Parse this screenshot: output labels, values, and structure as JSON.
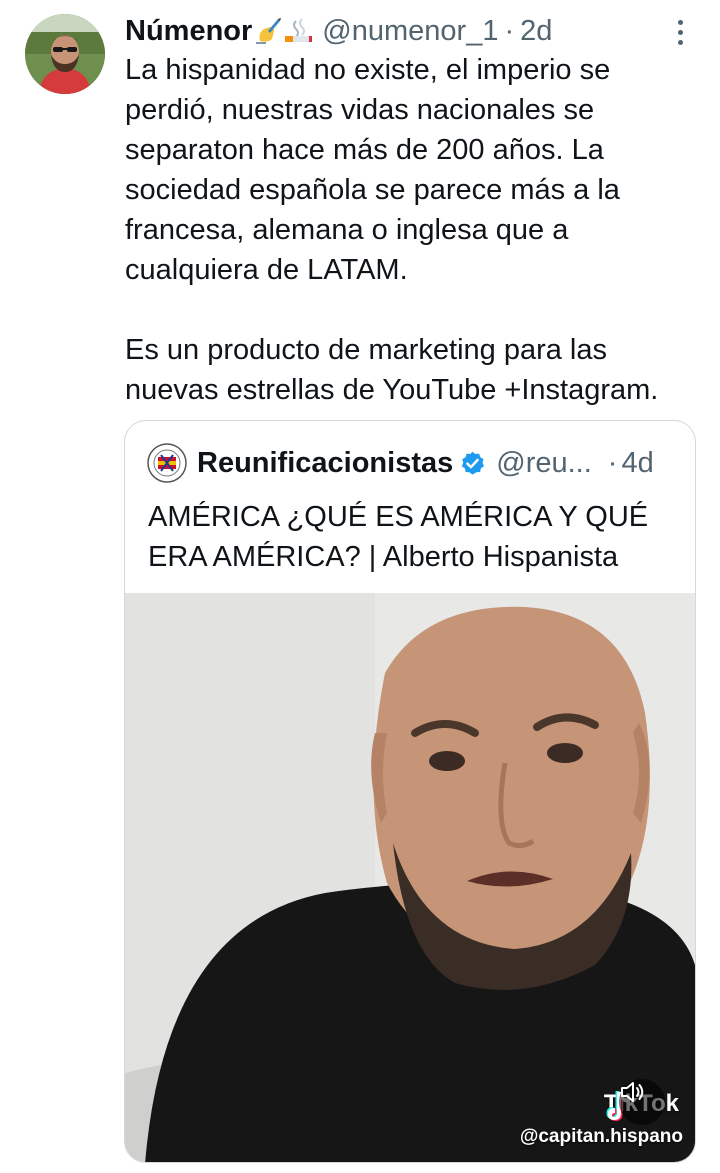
{
  "author": {
    "display_name": "Númenor",
    "name_emojis": [
      "writing-hand-emoji",
      "cigarette-emoji"
    ],
    "handle": "@numenor_1",
    "separator": "·",
    "time": "2d"
  },
  "tweet": {
    "paragraphs": [
      "La hispanidad no existe, el imperio se\nperdió, nuestras vidas nacionales se\nseparaton hace más de 200 años. La\nsociedad española se parece más a la\nfrancesa, alemana o inglesa que a\ncualquiera de LATAM.",
      "Es un producto de marketing para las\nnuevas estrellas de YouTube +Instagram."
    ]
  },
  "quoted": {
    "display_name": "Reunificacionistas",
    "verified": true,
    "handle": "@reu...",
    "separator": "·",
    "time": "4d",
    "text": "AMÉRICA ¿QUÉ ES AMÉRICA Y QUÉ\nERA AMÉRICA? | Alberto Hispanista",
    "media": {
      "watermark_brand": "TikTok",
      "watermark_user": "@capitan.hispano"
    }
  },
  "colors": {
    "primary_text": "#0f1419",
    "secondary_text": "#536471",
    "border": "#cfd9de",
    "verified": "#1d9bf0"
  }
}
